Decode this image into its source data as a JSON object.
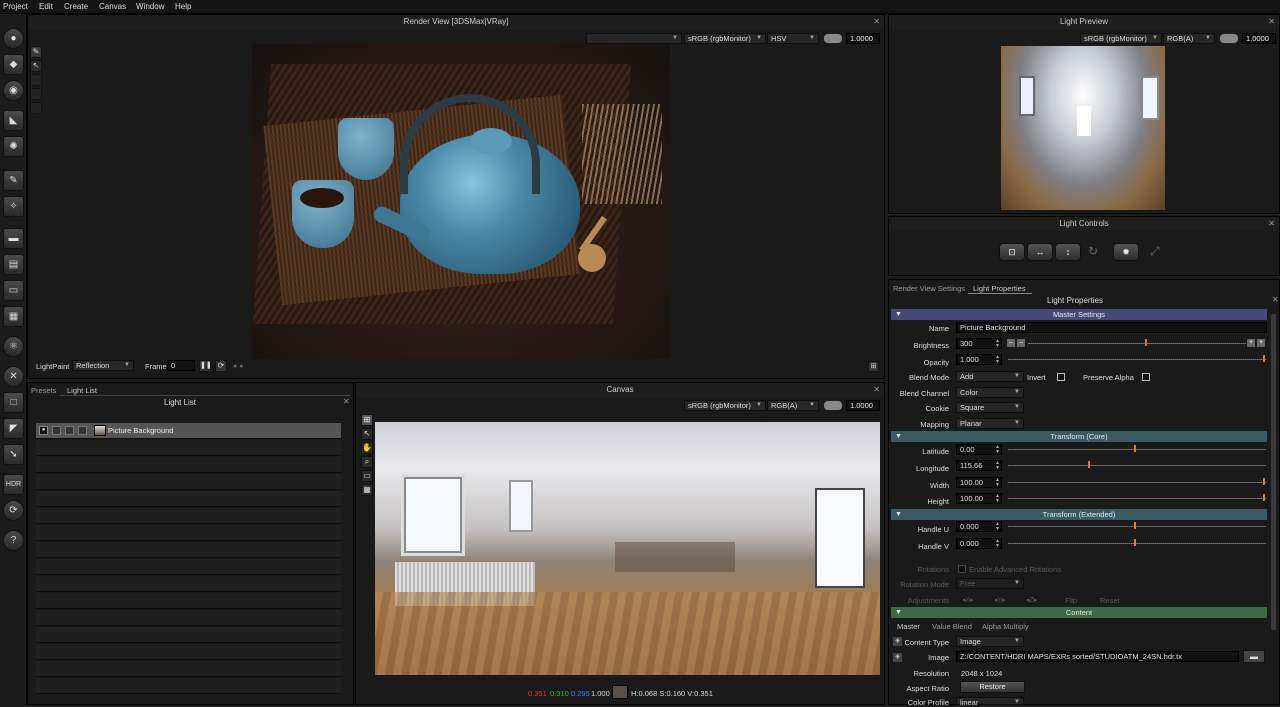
{
  "menu": [
    "Project",
    "Edit",
    "Create",
    "Canvas",
    "Window",
    "Help"
  ],
  "render_view": {
    "title": "Render View [3DSMax|VRay]",
    "color_space": "sRGB (rgbMonitor)",
    "channel": "HSV",
    "exposure": "1.0000",
    "lightpaint_label": "LightPaint",
    "lightpaint_mode": "Reflection",
    "frame_label": "Frame",
    "frame_value": "0"
  },
  "light_preview": {
    "title": "Light Preview",
    "color_space": "sRGB (rgbMonitor)",
    "channel": "RGB(A)",
    "exposure": "1.0000"
  },
  "light_controls": {
    "title": "Light Controls"
  },
  "left_panel": {
    "tabs": [
      "Presets",
      "Light List"
    ],
    "title": "Light List",
    "items": [
      "Picture Background"
    ]
  },
  "canvas": {
    "title": "Canvas",
    "color_space": "sRGB (rgbMonitor)",
    "channel": "RGB(A)",
    "exposure": "1.0000",
    "status_r": "0.351",
    "status_g": "0.310",
    "status_b": "0.295",
    "status_a": "1.000",
    "status_hsv": "H:0.068 S:0.160 V:0.351"
  },
  "props": {
    "tabs": [
      "Render View Settings",
      "Light Properties"
    ],
    "title": "Light Properties",
    "master_settings": "Master Settings",
    "name_label": "Name",
    "name_value": "Picture Background",
    "brightness_label": "Brightness",
    "brightness_value": "300",
    "opacity_label": "Opacity",
    "opacity_value": "1.000",
    "blend_mode_label": "Blend Mode",
    "blend_mode_value": "Add",
    "invert_label": "Invert",
    "preserve_alpha_label": "Preserve Alpha",
    "blend_channel_label": "Blend Channel",
    "blend_channel_value": "Color",
    "cookie_label": "Cookie",
    "cookie_value": "Square",
    "mapping_label": "Mapping",
    "mapping_value": "Planar",
    "transform_core": "Transform (Core)",
    "latitude_label": "Latitude",
    "latitude_value": "0.00",
    "longitude_label": "Longitude",
    "longitude_value": "115.66",
    "width_label": "Width",
    "width_value": "100.00",
    "height_label": "Height",
    "height_value": "100.00",
    "transform_extended": "Transform (Extended)",
    "handle_u_label": "Handle U",
    "handle_u_value": "0.000",
    "handle_v_label": "Handle V",
    "handle_v_value": "0.000",
    "rotations_label": "Rotations",
    "enable_adv_rot": "Enable Advanced Rotations",
    "rotation_mode_label": "Rotation Mode",
    "rotation_mode_value": "Free",
    "adjustments_label": "Adjustments",
    "flip_label": "Flip",
    "reset_label": "Reset",
    "content": "Content",
    "content_tabs": [
      "Master",
      "Value Blend",
      "Alpha Multiply"
    ],
    "content_type_label": "Content Type",
    "content_type_value": "Image",
    "image_label": "Image",
    "image_value": "Z:/CONTENT/HDRI MAPS/EXRs sorted/STUDIOATM_24SN.hdr.tx",
    "resolution_label": "Resolution",
    "resolution_value": "2048 x 1024",
    "aspect_ratio_label": "Aspect Ratio",
    "restore_label": "Restore",
    "color_profile_label": "Color Profile",
    "color_profile_value": "linear"
  },
  "toolbar_icons": [
    "sphere-light-icon",
    "rect-light-icon",
    "spot-light-icon",
    "flag-icon",
    "ring-light-icon",
    "brush-icon",
    "sparkle-icon",
    "strip-icon",
    "gradient-icon",
    "bar-icon",
    "pattern-icon",
    "atom-icon",
    "close-circle-icon",
    "square-icon",
    "fold-icon",
    "arrow-icon",
    "hdr-icon",
    "hdr-export-icon",
    "help-icon"
  ],
  "toolbar_text": {
    "hdr": "HDR",
    "help": "?"
  },
  "colors": {
    "accent_orange": "#e0801c",
    "section_teal": "#3a5a66",
    "section_master": "#44497a",
    "section_content": "#3d6a45"
  }
}
